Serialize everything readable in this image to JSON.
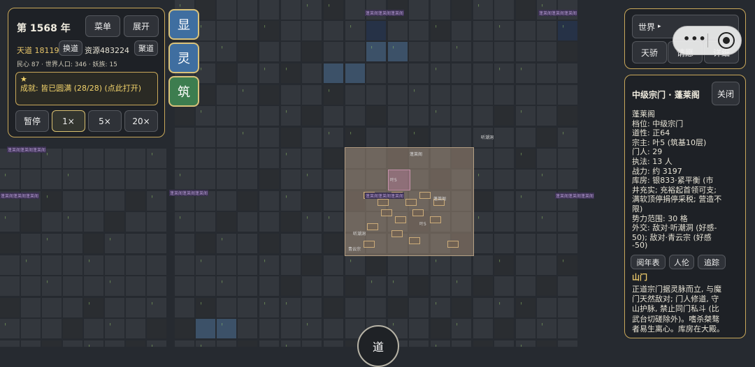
{
  "header": {
    "year_label": "第 1568 年",
    "menu_label": "菜单",
    "expand_label": "展开",
    "tiandao_label": "天道 18119",
    "swap_dao_label": "换道",
    "resources_label": "资源483224",
    "gather_dao_label": "聚道",
    "stats_line": "民心 87 · 世界人口: 346 · 妖族: 15"
  },
  "achievement": {
    "star": "★",
    "text": "成就: 皆已圆满 (28/28) (点此打开)"
  },
  "speed": {
    "pause_label": "暂停",
    "options": [
      "1×",
      "5×",
      "20×"
    ],
    "selected": "1×"
  },
  "side_buttons": {
    "show": "显",
    "spirit": "灵",
    "build": "筑"
  },
  "world_panel": {
    "dropdown_label": "世界",
    "dropdown_arrow": "▸",
    "buttons": [
      "天骄",
      "请愿",
      "详细"
    ]
  },
  "capsule": {
    "dots": "•••"
  },
  "sect_panel": {
    "title": "中级宗门 · 蓬莱阁",
    "close_label": "关闭",
    "lines": [
      "蓬莱阁",
      "档位: 中级宗门",
      "道性: 正64",
      "宗主: 叶5 (筑基10层)",
      "门人: 29",
      "执法: 13 人",
      "战力: 约 3197",
      "库房: 银833·紧平衡 (市",
      "井充实; 充裕起首领可支;",
      "满软顶停捐停采税; 营造不",
      "限)",
      "势力范围: 30 格",
      "外交: 敌对·听潮洞 (好感-",
      "50); 敌对·青云宗 (好感",
      "-50)"
    ],
    "tabs": [
      "阅年表",
      "人伦",
      "追踪"
    ],
    "section_title": "山门",
    "section_lines": [
      "正道宗门据灵脉而立, 与魔",
      "门天然敌对; 门人修道, 守",
      "山护脉, 禁止同门私斗 (比",
      "武台切磋除外)。嗜杀桀骜",
      "者易生离心。库房在大殿。"
    ]
  },
  "bottom_button": {
    "label": "道"
  },
  "map_labels": {
    "corner_tag": "蓬莱阁蓬莱阁蓬莱阁",
    "sect_name": "蓬莱阁",
    "label_a": "叶5",
    "label_b": "听潮洞",
    "label_c": "青云宗"
  },
  "colors": {
    "accent_gold": "#c9a85a",
    "panel_bg": "#1e2126",
    "side_button_blue": "#3f6ea0",
    "side_button_green": "#3d7d4f",
    "text_gold": "#e8c66a"
  }
}
